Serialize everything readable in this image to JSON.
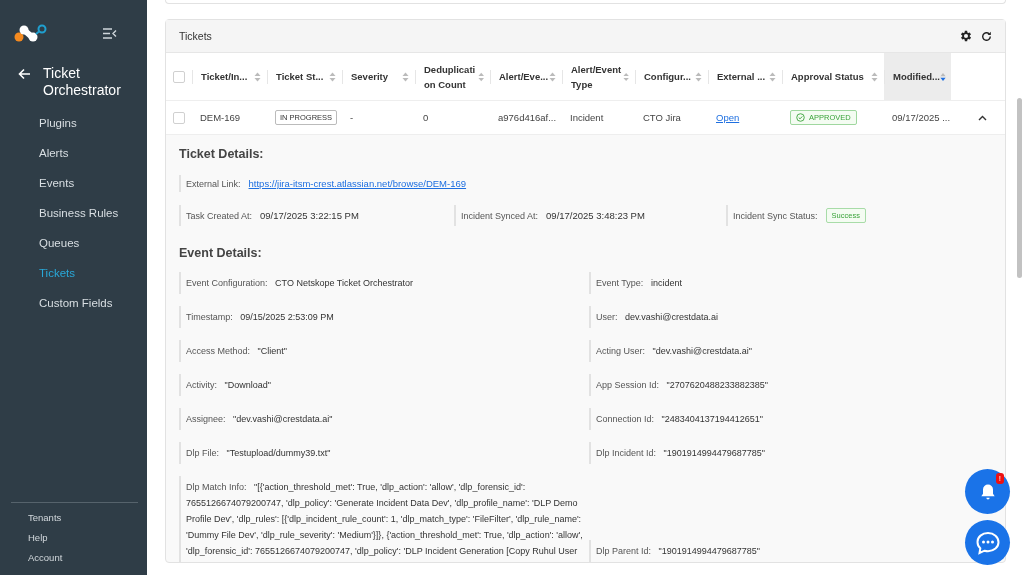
{
  "sidebar": {
    "title": "Ticket Orchestrator",
    "items": [
      {
        "label": "Plugins",
        "selected": false
      },
      {
        "label": "Alerts",
        "selected": false
      },
      {
        "label": "Events",
        "selected": false
      },
      {
        "label": "Business Rules",
        "selected": false
      },
      {
        "label": "Queues",
        "selected": false
      },
      {
        "label": "Tickets",
        "selected": true
      },
      {
        "label": "Custom Fields",
        "selected": false
      }
    ],
    "footer": [
      "Tenants",
      "Help",
      "Account"
    ]
  },
  "card": {
    "title": "Tickets"
  },
  "table": {
    "all_checked": false,
    "columns": [
      {
        "label": "Ticket/In...",
        "sorted": false
      },
      {
        "label": "Ticket St...",
        "sorted": false
      },
      {
        "label": "Severity",
        "sorted": false
      },
      {
        "label": "Deduplication Count",
        "sorted": false
      },
      {
        "label": "Alert/Eve...",
        "sorted": false
      },
      {
        "label": "Alert/Event Type",
        "sorted": false
      },
      {
        "label": "Configur...",
        "sorted": false
      },
      {
        "label": "External ...",
        "sorted": false
      },
      {
        "label": "Approval Status",
        "sorted": false
      },
      {
        "label": "Modified...",
        "sorted": true
      }
    ],
    "rows": [
      {
        "checked": false,
        "expanded": true,
        "cells": [
          {
            "kind": "text",
            "text": "DEM-169"
          },
          {
            "kind": "tag",
            "text": "IN PROGRESS"
          },
          {
            "kind": "text",
            "text": "-"
          },
          {
            "kind": "text",
            "text": "0"
          },
          {
            "kind": "text",
            "text": "a976d416af..."
          },
          {
            "kind": "text",
            "text": "Incident"
          },
          {
            "kind": "text",
            "text": "CTO Jira"
          },
          {
            "kind": "link",
            "text": "Open"
          },
          {
            "kind": "approved",
            "text": "APPROVED"
          },
          {
            "kind": "text",
            "text": "09/17/2025 ..."
          }
        ]
      }
    ]
  },
  "ticket_details": {
    "heading": "Ticket Details:",
    "external_link": {
      "label": "External Link:",
      "value": "https://jira-itsm-crest.atlassian.net/browse/DEM-169"
    },
    "fields": [
      {
        "kind": "text",
        "label": "Task Created At:",
        "value": "09/17/2025 3:22:15 PM"
      },
      {
        "kind": "text",
        "label": "Incident Synced At:",
        "value": "09/17/2025 3:48:23 PM"
      },
      {
        "kind": "badge",
        "label": "Incident Sync Status:",
        "value": "Success"
      }
    ]
  },
  "event_details": {
    "heading": "Event Details:",
    "rows": [
      [
        {
          "label": "Event Configuration:",
          "value": "CTO Netskope Ticket Orchestrator"
        },
        {
          "label": "Event Type:",
          "value": "incident"
        }
      ],
      [
        {
          "label": "Timestamp:",
          "value": "09/15/2025 2:53:09 PM"
        },
        {
          "label": "User:",
          "value": "dev.vashi@crestdata.ai"
        }
      ],
      [
        {
          "label": "Access Method:",
          "value": "\"Client\""
        },
        {
          "label": "Acting User:",
          "value": "\"dev.vashi@crestdata.ai\""
        }
      ],
      [
        {
          "label": "Activity:",
          "value": "\"Download\""
        },
        {
          "label": "App Session Id:",
          "value": "\"2707620488233882385\""
        }
      ],
      [
        {
          "label": "Assignee:",
          "value": "\"dev.vashi@crestdata.ai\""
        },
        {
          "label": "Connection Id:",
          "value": "\"2483404137194412651\""
        }
      ],
      [
        {
          "label": "Dlp File:",
          "value": "\"Testupload/dummy39.txt\""
        },
        {
          "label": "Dlp Incident Id:",
          "value": "\"1901914994479687785\""
        }
      ],
      [
        {
          "label": "Dlp Match Info:",
          "value": "\"[{'action_threshold_met': True, 'dlp_action': 'allow', 'dlp_forensic_id': 7655126674079200747, 'dlp_policy': 'Generate Incident Data Dev', 'dlp_profile_name': 'DLP Demo Profile Dev', 'dlp_rules': [{'dlp_incident_rule_count': 1, 'dlp_match_type': 'FileFilter', 'dlp_rule_name': 'Dummy File Dev', 'dlp_rule_severity': 'Medium'}]}, {'action_threshold_met': True, 'dlp_action': 'allow', 'dlp_forensic_id': 7655126674079200747, 'dlp_policy': 'DLP Incident Generation [Copy Ruhul User"
        },
        {
          "label": "Dlp Parent Id:",
          "value": "\"1901914994479687785\""
        }
      ]
    ]
  },
  "notifications": {
    "badge": "!"
  }
}
